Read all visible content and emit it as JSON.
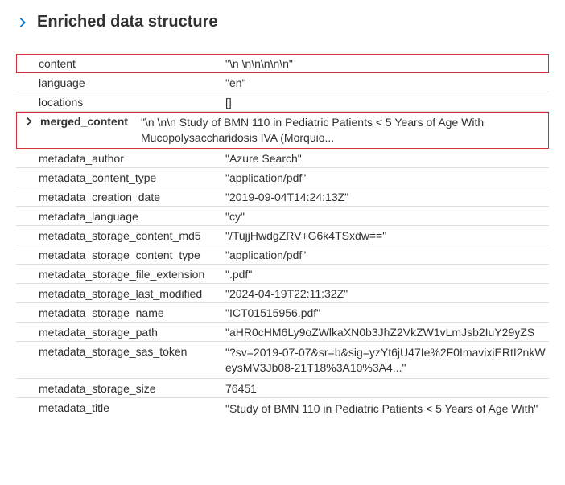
{
  "header": {
    "title": "Enriched data structure"
  },
  "fields": {
    "content": {
      "key": "content",
      "value": "\"\\n \\n\\n\\n\\n\\n\""
    },
    "language": {
      "key": "language",
      "value": "\"en\""
    },
    "locations": {
      "key": "locations",
      "value": "[]"
    },
    "merged_content": {
      "key": "merged_content",
      "value": "\"\\n \\n\\n Study of BMN 110 in Pediatric Patients < 5 Years of Age With Mucopolysaccharidosis IVA (Morquio..."
    },
    "metadata_author": {
      "key": "metadata_author",
      "value": "\"Azure Search\""
    },
    "metadata_content_type": {
      "key": "metadata_content_type",
      "value": "\"application/pdf\""
    },
    "metadata_creation_date": {
      "key": "metadata_creation_date",
      "value": "\"2019-09-04T14:24:13Z\""
    },
    "metadata_language": {
      "key": "metadata_language",
      "value": "\"cy\""
    },
    "metadata_storage_content_md5": {
      "key": "metadata_storage_content_md5",
      "value": "\"/TujjHwdgZRV+G6k4TSxdw==\""
    },
    "metadata_storage_content_type": {
      "key": "metadata_storage_content_type",
      "value": "\"application/pdf\""
    },
    "metadata_storage_file_extension": {
      "key": "metadata_storage_file_extension",
      "value": "\".pdf\""
    },
    "metadata_storage_last_modified": {
      "key": "metadata_storage_last_modified",
      "value": "\"2024-04-19T22:11:32Z\""
    },
    "metadata_storage_name": {
      "key": "metadata_storage_name",
      "value": "\"ICT01515956.pdf\""
    },
    "metadata_storage_path": {
      "key": "metadata_storage_path",
      "value": "\"aHR0cHM6Ly9oZWlkaXN0b3JhZ2VkZW1vLmJsb2IuY29yZS"
    },
    "metadata_storage_sas_token": {
      "key": "metadata_storage_sas_token",
      "value": "\"?sv=2019-07-07&sr=b&sig=yzYt6jU47Ie%2F0ImavixiERtI2nkWeysMV3Jb08-21T18%3A10%3A4...\""
    },
    "metadata_storage_size": {
      "key": "metadata_storage_size",
      "value": "76451"
    },
    "metadata_title": {
      "key": "metadata_title",
      "value": "\"Study of BMN 110 in Pediatric Patients < 5 Years of Age With\""
    }
  }
}
